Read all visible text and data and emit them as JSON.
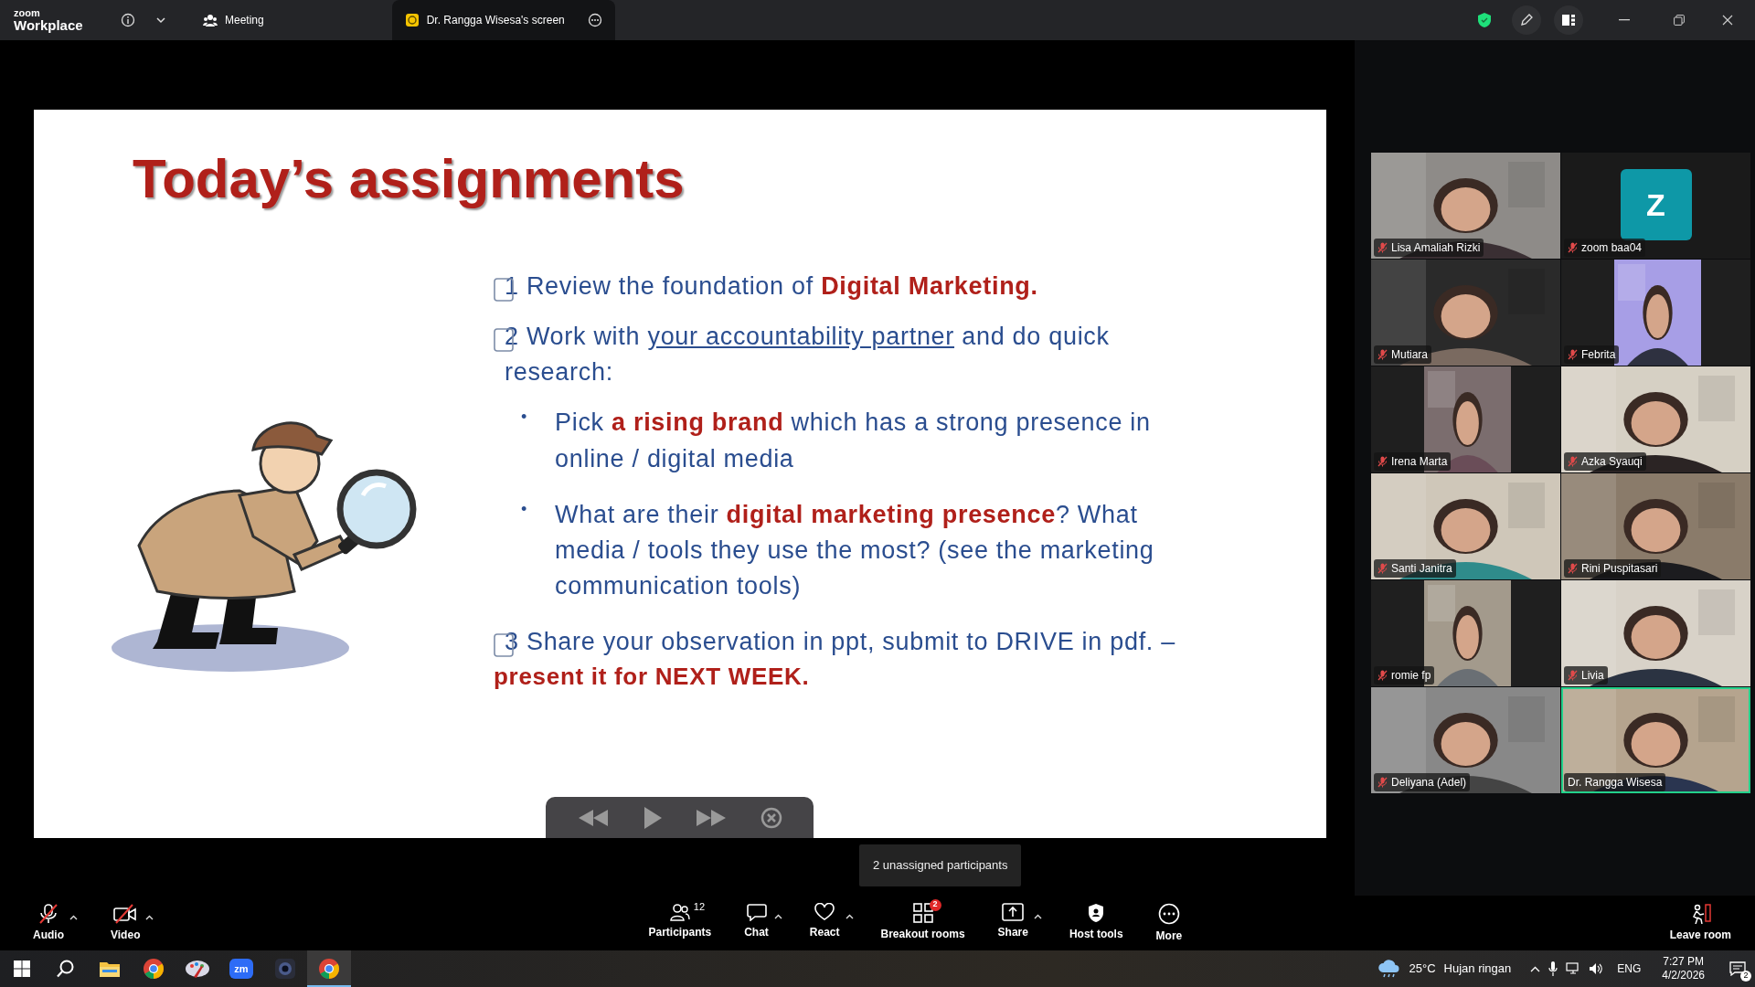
{
  "top_bar": {
    "logo": {
      "line1": "zoom",
      "line2": "Workplace"
    },
    "tabs": [
      {
        "kind": "meeting",
        "label": "Meeting",
        "selected": false
      },
      {
        "kind": "share",
        "label": "Dr. Rangga Wisesa's screen",
        "selected": true
      }
    ]
  },
  "slide": {
    "title": "Today’s assignments",
    "items": [
      {
        "kind": "task",
        "number": "1",
        "text": "Review the foundation of **Digital Marketing.**"
      },
      {
        "kind": "task",
        "number": "2",
        "text": "Work with",
        "link": "your accountability partner",
        "text_after": "and do quick research:"
      },
      {
        "kind": "bullet",
        "marker": "•",
        "text": "Pick **a rising brand** which has a strong presence in online / digital media"
      },
      {
        "kind": "bullet",
        "marker": "•",
        "text": "What are their **digital marketing presence**? What media / tools they use the most? (see the marketing communication tools)"
      },
      {
        "kind": "task",
        "number": "3",
        "text": "Share your observation in ppt, submit to DRIVE in pdf.  –",
        "emphasis": "present it for NEXT WEEK."
      }
    ]
  },
  "tooltip": "2 unassigned participants",
  "participants": [
    {
      "name": "Lisa Amaliah Rizki",
      "kind": "video",
      "muted": true,
      "speaking": false
    },
    {
      "name": "zoom baa04",
      "kind": "avatar",
      "initial": "Z",
      "muted": true,
      "speaking": false
    },
    {
      "name": "Mutiara",
      "kind": "video",
      "muted": true,
      "speaking": false
    },
    {
      "name": "Febrita",
      "kind": "portrait",
      "muted": true,
      "speaking": false
    },
    {
      "name": "Irena Marta",
      "kind": "portrait",
      "muted": true,
      "speaking": false
    },
    {
      "name": "Azka Syauqi",
      "kind": "video",
      "muted": true,
      "speaking": false
    },
    {
      "name": "Santi Janitra",
      "kind": "video",
      "muted": true,
      "speaking": false
    },
    {
      "name": "Rini Puspitasari",
      "kind": "video",
      "muted": true,
      "speaking": false
    },
    {
      "name": "romie fp",
      "kind": "portrait",
      "muted": true,
      "speaking": false
    },
    {
      "name": "Livia",
      "kind": "video",
      "muted": true,
      "speaking": false
    },
    {
      "name": "Deliyana (Adel)",
      "kind": "video",
      "muted": true,
      "speaking": false
    },
    {
      "name": "Dr. Rangga Wisesa",
      "kind": "video",
      "muted": false,
      "speaking": true
    }
  ],
  "toolbar": {
    "left": [
      {
        "kind": "audio",
        "label": "Audio",
        "off": true,
        "caret": true
      },
      {
        "kind": "video",
        "label": "Video",
        "off": true,
        "caret": true
      }
    ],
    "center": [
      {
        "kind": "participants",
        "label": "Participants",
        "count": "12",
        "caret": false
      },
      {
        "kind": "chat",
        "label": "Chat",
        "caret": true
      },
      {
        "kind": "react",
        "label": "React",
        "caret": true
      },
      {
        "kind": "breakout",
        "label": "Breakout rooms",
        "badge": "2",
        "caret": false
      },
      {
        "kind": "share",
        "label": "Share",
        "caret": true
      },
      {
        "kind": "host",
        "label": "Host tools",
        "caret": false
      },
      {
        "kind": "more",
        "label": "More",
        "caret": false
      }
    ],
    "leave": "Leave room"
  },
  "taskbar": {
    "apps": [
      {
        "kind": "explorer",
        "active": false
      },
      {
        "kind": "chrome",
        "active": false
      },
      {
        "kind": "paint",
        "active": false
      },
      {
        "kind": "zoom",
        "label": "zm",
        "active": false
      },
      {
        "kind": "camera",
        "active": false
      },
      {
        "kind": "chrome",
        "active": true
      }
    ],
    "weather": {
      "temp": "25°C",
      "text": "Hujan ringan"
    },
    "language": "ENG",
    "time": "7:27 PM",
    "date": "4/2/2026",
    "notifications": "2"
  }
}
